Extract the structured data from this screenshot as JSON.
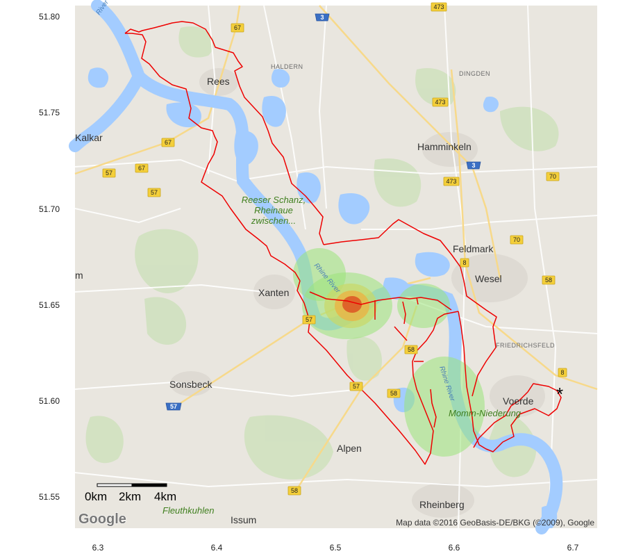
{
  "map": {
    "y_ticks": [
      "51.80",
      "51.75",
      "51.70",
      "51.65",
      "51.60",
      "51.55"
    ],
    "x_ticks": [
      "6.3",
      "6.4",
      "6.5",
      "6.6",
      "6.7"
    ],
    "towns": [
      "Rees",
      "Kalkar",
      "Hamminkeln",
      "Xanten",
      "Wesel",
      "Feldmark",
      "Sonsbeck",
      "Voerde",
      "Alpen",
      "Rheinberg",
      "Issum",
      "m"
    ],
    "villages": [
      "HALDERN",
      "DINGDEN",
      "FRIEDRICHSFELD"
    ],
    "parks": [
      "Reeser Schanz,",
      "Rheinaue",
      "zwischen...",
      "Momm-Niederung",
      "Fleuthkuhlen"
    ],
    "rivers": [
      "River",
      "Rhine River",
      "Rhine River"
    ],
    "road_shields": [
      "473",
      "3",
      "67",
      "67",
      "67",
      "57",
      "57",
      "473",
      "3",
      "473",
      "70",
      "70",
      "8",
      "58",
      "57",
      "58",
      "57",
      "58",
      "58",
      "8",
      "57",
      "58"
    ],
    "scale_bar": {
      "labels": [
        "0km",
        "2km",
        "4km"
      ]
    },
    "start_marker": "*",
    "logo": "Google",
    "attribution": "Map data ©2016 GeoBasis-DE/BKG (©2009), Google"
  },
  "colors": {
    "map_background": "#e9e6df",
    "water": "#a3ccff",
    "route": "#ee0000",
    "heat_low": "#9be37a",
    "heat_mid": "#e8b648",
    "heat_high": "#dd5a26"
  }
}
